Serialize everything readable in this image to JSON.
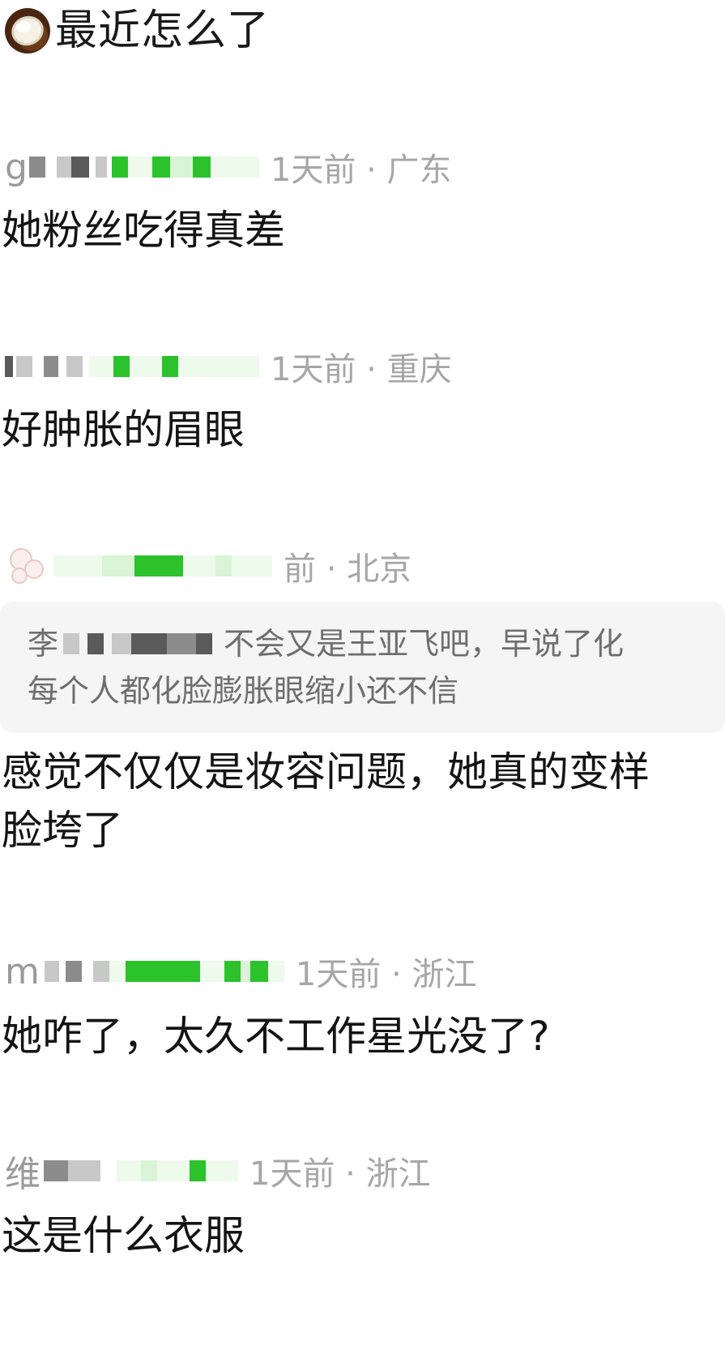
{
  "top": {
    "icon": "coconut-icon",
    "title": "最近怎么了"
  },
  "comments": [
    {
      "username_visible": "g",
      "meta": "1天前 · 广东",
      "text": "她粉丝吃得真差"
    },
    {
      "username_visible": "",
      "meta": "1天前 · 重庆",
      "text": "好肿胀的眉眼"
    },
    {
      "username_visible": "",
      "meta": "前 · 北京",
      "quote": {
        "author_visible": "李",
        "line1": "不会又是王亚飞吧，早说了化",
        "line2": "每个人都化脸膨胀眼缩小还不信"
      },
      "text_line1": "感觉不仅仅是妆容问题，她真的变样",
      "text_line2": "脸垮了"
    },
    {
      "username_visible": "m",
      "meta": "1天前 · 浙江",
      "text": "她咋了，太久不工作星光没了?"
    },
    {
      "username_visible": "维",
      "meta": "1天前 · 浙江",
      "text": "这是什么衣服"
    }
  ],
  "colors": {
    "meta_gray": "#a6a6a6",
    "text": "#141414",
    "mask_green": "#2bc22b",
    "quote_bg": "#f5f5f5"
  }
}
